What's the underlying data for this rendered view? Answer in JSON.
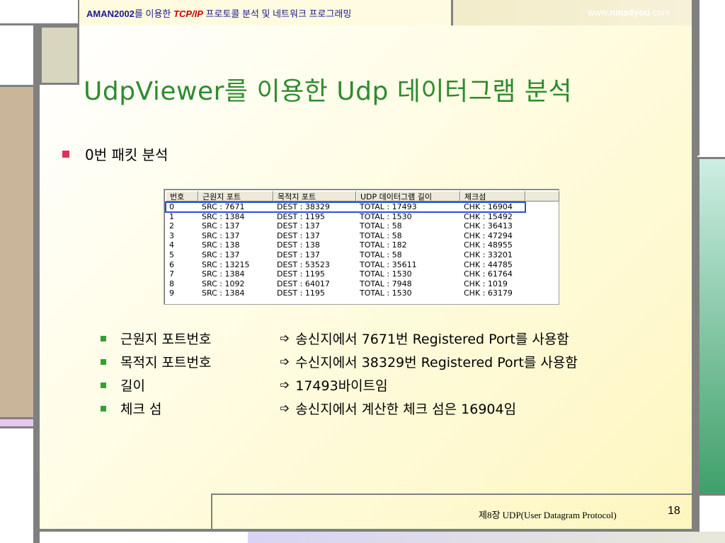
{
  "header": {
    "left_prefix": "AMAN2002",
    "left_mid": "를 이용한 ",
    "left_tcp": "TCP/IP",
    "left_suffix": " 프로토콜 분석 및 네트워크 프로그래밍",
    "right_www": "www.",
    "right_bold": "nms4you",
    "right_com": ".com"
  },
  "title": "UdpViewer를 이용한 Udp 데이터그램 분석",
  "bullet": "0번 패킷 분석",
  "list": {
    "columns": [
      "번호",
      "근원지 포트",
      "목적지 포트",
      "UDP 데이터그램 길이",
      "체크섬",
      ""
    ],
    "rows": [
      [
        "0",
        "SRC  : 7671",
        "DEST : 38329",
        "TOTAL : 17493",
        "CHK : 16904"
      ],
      [
        "1",
        "SRC  : 1384",
        "DEST : 1195",
        "TOTAL : 1530",
        "CHK : 15492"
      ],
      [
        "2",
        "SRC  : 137",
        "DEST : 137",
        "TOTAL : 58",
        "CHK : 36413"
      ],
      [
        "3",
        "SRC  : 137",
        "DEST : 137",
        "TOTAL : 58",
        "CHK : 47294"
      ],
      [
        "4",
        "SRC  : 138",
        "DEST : 138",
        "TOTAL : 182",
        "CHK : 48955"
      ],
      [
        "5",
        "SRC  : 137",
        "DEST : 137",
        "TOTAL : 58",
        "CHK : 33201"
      ],
      [
        "6",
        "SRC  : 13215",
        "DEST : 53523",
        "TOTAL : 35611",
        "CHK : 44785"
      ],
      [
        "7",
        "SRC  : 1384",
        "DEST : 1195",
        "TOTAL : 1530",
        "CHK : 61764"
      ],
      [
        "8",
        "SRC  : 1092",
        "DEST : 64017",
        "TOTAL : 7948",
        "CHK : 1019"
      ],
      [
        "9",
        "SRC  : 1384",
        "DEST : 1195",
        "TOTAL : 1530",
        "CHK : 63179"
      ]
    ],
    "selected_index": 0
  },
  "details": [
    {
      "label": "근원지 포트번호",
      "text": "송신지에서 7671번 Registered Port를 사용함"
    },
    {
      "label": "목적지 포트번호",
      "text": "수신지에서 38329번 Registered Port를 사용함"
    },
    {
      "label": "길이",
      "text": "17493바이트임"
    },
    {
      "label": "체크 섬",
      "text": "송신지에서 계산한 체크 섬은 16904임"
    }
  ],
  "arrow_glyph": "➩",
  "footer": {
    "chapter": "제8장  UDP(User Datagram Protocol)",
    "page": "18"
  },
  "colors": {
    "title": "#2e8b2e",
    "bullet_main": "#e0305a",
    "bullet_sub": "#33a036",
    "selection": "#2b4fd6"
  }
}
